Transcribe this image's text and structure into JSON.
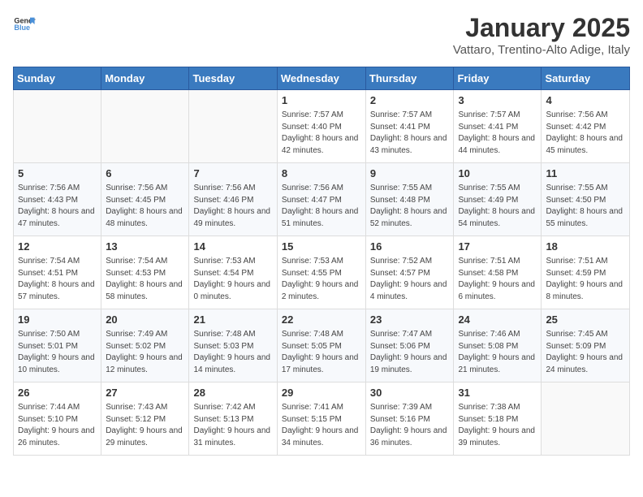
{
  "logo": {
    "text_general": "General",
    "text_blue": "Blue"
  },
  "title": "January 2025",
  "subtitle": "Vattaro, Trentino-Alto Adige, Italy",
  "days_of_week": [
    "Sunday",
    "Monday",
    "Tuesday",
    "Wednesday",
    "Thursday",
    "Friday",
    "Saturday"
  ],
  "weeks": [
    [
      {
        "day": "",
        "info": ""
      },
      {
        "day": "",
        "info": ""
      },
      {
        "day": "",
        "info": ""
      },
      {
        "day": "1",
        "info": "Sunrise: 7:57 AM\nSunset: 4:40 PM\nDaylight: 8 hours and 42 minutes."
      },
      {
        "day": "2",
        "info": "Sunrise: 7:57 AM\nSunset: 4:41 PM\nDaylight: 8 hours and 43 minutes."
      },
      {
        "day": "3",
        "info": "Sunrise: 7:57 AM\nSunset: 4:41 PM\nDaylight: 8 hours and 44 minutes."
      },
      {
        "day": "4",
        "info": "Sunrise: 7:56 AM\nSunset: 4:42 PM\nDaylight: 8 hours and 45 minutes."
      }
    ],
    [
      {
        "day": "5",
        "info": "Sunrise: 7:56 AM\nSunset: 4:43 PM\nDaylight: 8 hours and 47 minutes."
      },
      {
        "day": "6",
        "info": "Sunrise: 7:56 AM\nSunset: 4:45 PM\nDaylight: 8 hours and 48 minutes."
      },
      {
        "day": "7",
        "info": "Sunrise: 7:56 AM\nSunset: 4:46 PM\nDaylight: 8 hours and 49 minutes."
      },
      {
        "day": "8",
        "info": "Sunrise: 7:56 AM\nSunset: 4:47 PM\nDaylight: 8 hours and 51 minutes."
      },
      {
        "day": "9",
        "info": "Sunrise: 7:55 AM\nSunset: 4:48 PM\nDaylight: 8 hours and 52 minutes."
      },
      {
        "day": "10",
        "info": "Sunrise: 7:55 AM\nSunset: 4:49 PM\nDaylight: 8 hours and 54 minutes."
      },
      {
        "day": "11",
        "info": "Sunrise: 7:55 AM\nSunset: 4:50 PM\nDaylight: 8 hours and 55 minutes."
      }
    ],
    [
      {
        "day": "12",
        "info": "Sunrise: 7:54 AM\nSunset: 4:51 PM\nDaylight: 8 hours and 57 minutes."
      },
      {
        "day": "13",
        "info": "Sunrise: 7:54 AM\nSunset: 4:53 PM\nDaylight: 8 hours and 58 minutes."
      },
      {
        "day": "14",
        "info": "Sunrise: 7:53 AM\nSunset: 4:54 PM\nDaylight: 9 hours and 0 minutes."
      },
      {
        "day": "15",
        "info": "Sunrise: 7:53 AM\nSunset: 4:55 PM\nDaylight: 9 hours and 2 minutes."
      },
      {
        "day": "16",
        "info": "Sunrise: 7:52 AM\nSunset: 4:57 PM\nDaylight: 9 hours and 4 minutes."
      },
      {
        "day": "17",
        "info": "Sunrise: 7:51 AM\nSunset: 4:58 PM\nDaylight: 9 hours and 6 minutes."
      },
      {
        "day": "18",
        "info": "Sunrise: 7:51 AM\nSunset: 4:59 PM\nDaylight: 9 hours and 8 minutes."
      }
    ],
    [
      {
        "day": "19",
        "info": "Sunrise: 7:50 AM\nSunset: 5:01 PM\nDaylight: 9 hours and 10 minutes."
      },
      {
        "day": "20",
        "info": "Sunrise: 7:49 AM\nSunset: 5:02 PM\nDaylight: 9 hours and 12 minutes."
      },
      {
        "day": "21",
        "info": "Sunrise: 7:48 AM\nSunset: 5:03 PM\nDaylight: 9 hours and 14 minutes."
      },
      {
        "day": "22",
        "info": "Sunrise: 7:48 AM\nSunset: 5:05 PM\nDaylight: 9 hours and 17 minutes."
      },
      {
        "day": "23",
        "info": "Sunrise: 7:47 AM\nSunset: 5:06 PM\nDaylight: 9 hours and 19 minutes."
      },
      {
        "day": "24",
        "info": "Sunrise: 7:46 AM\nSunset: 5:08 PM\nDaylight: 9 hours and 21 minutes."
      },
      {
        "day": "25",
        "info": "Sunrise: 7:45 AM\nSunset: 5:09 PM\nDaylight: 9 hours and 24 minutes."
      }
    ],
    [
      {
        "day": "26",
        "info": "Sunrise: 7:44 AM\nSunset: 5:10 PM\nDaylight: 9 hours and 26 minutes."
      },
      {
        "day": "27",
        "info": "Sunrise: 7:43 AM\nSunset: 5:12 PM\nDaylight: 9 hours and 29 minutes."
      },
      {
        "day": "28",
        "info": "Sunrise: 7:42 AM\nSunset: 5:13 PM\nDaylight: 9 hours and 31 minutes."
      },
      {
        "day": "29",
        "info": "Sunrise: 7:41 AM\nSunset: 5:15 PM\nDaylight: 9 hours and 34 minutes."
      },
      {
        "day": "30",
        "info": "Sunrise: 7:39 AM\nSunset: 5:16 PM\nDaylight: 9 hours and 36 minutes."
      },
      {
        "day": "31",
        "info": "Sunrise: 7:38 AM\nSunset: 5:18 PM\nDaylight: 9 hours and 39 minutes."
      },
      {
        "day": "",
        "info": ""
      }
    ]
  ]
}
